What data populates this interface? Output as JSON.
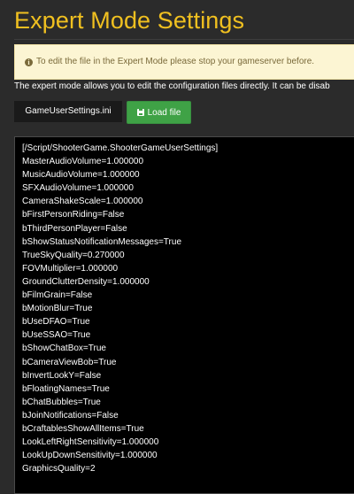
{
  "header": {
    "title": "Expert Mode Settings"
  },
  "alert": {
    "icon": "info-circle-icon",
    "text": "To edit the file in the Expert Mode please stop your gameserver before."
  },
  "description": "The expert mode allows you to edit the configuration files directly. It can be disab",
  "toolbar": {
    "file_tab_label": "GameUserSettings.ini",
    "load_button_icon": "floppy-disk-icon",
    "load_button_label": "Load file"
  },
  "colors": {
    "title": "#f0c020",
    "background": "#2b2b2b",
    "alert_background": "#fcf5d3",
    "load_button": "#3fa246",
    "editor_background": "#000000"
  },
  "editor": {
    "lines": [
      "[/Script/ShooterGame.ShooterGameUserSettings]",
      "MasterAudioVolume=1.000000",
      "MusicAudioVolume=1.000000",
      "SFXAudioVolume=1.000000",
      "CameraShakeScale=1.000000",
      "bFirstPersonRiding=False",
      "bThirdPersonPlayer=False",
      "bShowStatusNotificationMessages=True",
      "TrueSkyQuality=0.270000",
      "FOVMultiplier=1.000000",
      "GroundClutterDensity=1.000000",
      "bFilmGrain=False",
      "bMotionBlur=True",
      "bUseDFAO=True",
      "bUseSSAO=True",
      "bShowChatBox=True",
      "bCameraViewBob=True",
      "bInvertLookY=False",
      "bFloatingNames=True",
      "bChatBubbles=True",
      "bJoinNotifications=False",
      "bCraftablesShowAllItems=True",
      "LookLeftRightSensitivity=1.000000",
      "LookUpDownSensitivity=1.000000",
      "GraphicsQuality=2"
    ]
  }
}
